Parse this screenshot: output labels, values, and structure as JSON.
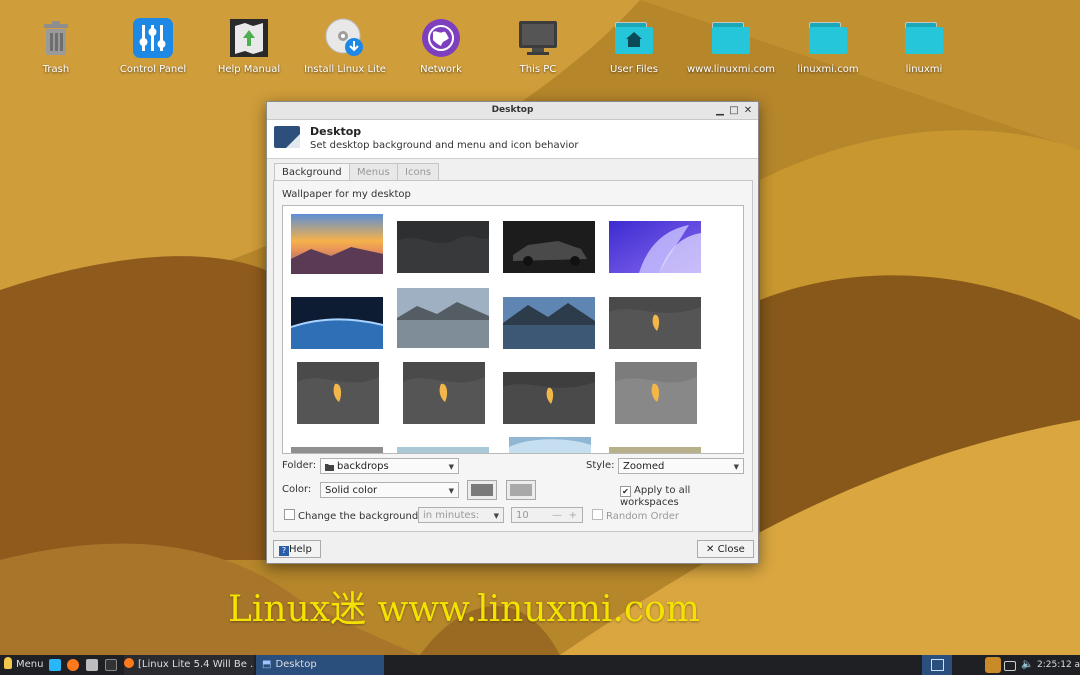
{
  "desktop": {
    "icons": [
      {
        "label": "Trash",
        "icon": "trash-icon"
      },
      {
        "label": "Control Panel",
        "icon": "control-panel-icon"
      },
      {
        "label": "Help Manual",
        "icon": "help-manual-icon"
      },
      {
        "label": "Install Linux Lite",
        "icon": "install-disc-icon"
      },
      {
        "label": "Network",
        "icon": "network-icon"
      },
      {
        "label": "This PC",
        "icon": "monitor-icon"
      },
      {
        "label": "User Files",
        "icon": "home-folder-icon"
      },
      {
        "label": "www.linuxmi.com",
        "icon": "folder-icon"
      },
      {
        "label": "linuxmi.com",
        "icon": "folder-icon"
      },
      {
        "label": "linuxmi",
        "icon": "folder-icon"
      }
    ],
    "watermark": "Linux迷 www.linuxmi.com"
  },
  "dialog": {
    "window_title": "Desktop",
    "header_title": "Desktop",
    "header_subtitle": "Set desktop background and menu and icon behavior",
    "tabs": [
      {
        "label": "Background",
        "active": true
      },
      {
        "label": "Menus",
        "active": false
      },
      {
        "label": "Icons",
        "active": false
      }
    ],
    "wallpaper_label": "Wallpaper for my desktop",
    "folder_label": "Folder:",
    "folder_value": "backdrops",
    "style_label": "Style:",
    "style_value": "Zoomed",
    "color_label": "Color:",
    "color_value": "Solid color",
    "color1": "#7a7a7a",
    "color2": "#a9a9a9",
    "apply_all_label": "Apply to all workspaces",
    "apply_all_checked": true,
    "change_bg_label": "Change the background",
    "change_bg_checked": false,
    "interval_unit": "in minutes:",
    "interval_value": "10",
    "random_order_label": "Random Order",
    "help_label": "Help",
    "close_label": "Close"
  },
  "taskbar": {
    "menu_label": "Menu",
    "task1_label": "[Linux Lite 5.4 Will Be ...",
    "task2_label": "Desktop",
    "clock": "2:25:12 am"
  },
  "colors": {
    "accent": "#2a5ea8",
    "taskbar_bg": "#1f2024",
    "desktop_bg": "#b6862b",
    "folder": "#26c6da"
  }
}
